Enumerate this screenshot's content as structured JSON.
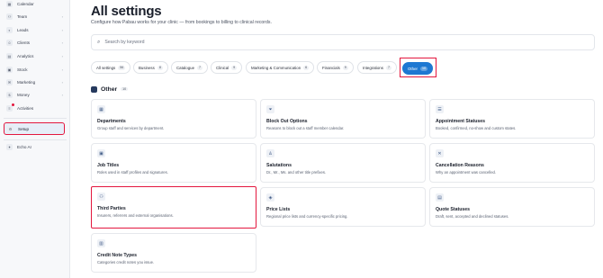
{
  "sidebar": {
    "items": [
      {
        "label": "Calendar",
        "icon": "calendar-icon",
        "glyph": "▦",
        "chevron": ""
      },
      {
        "label": "Team",
        "icon": "team-icon",
        "glyph": "⚇",
        "chevron": "›"
      },
      {
        "label": "Leads",
        "icon": "leads-icon",
        "glyph": "◐",
        "chevron": "›"
      },
      {
        "label": "Clients",
        "icon": "clients-icon",
        "glyph": "☺",
        "chevron": "›"
      },
      {
        "label": "Analytics",
        "icon": "analytics-icon",
        "glyph": "▤",
        "chevron": "›"
      },
      {
        "label": "Stock",
        "icon": "stock-icon",
        "glyph": "▣",
        "chevron": "›"
      },
      {
        "label": "Marketing",
        "icon": "marketing-icon",
        "glyph": "✉",
        "chevron": "›"
      },
      {
        "label": "Money",
        "icon": "money-icon",
        "glyph": "$",
        "chevron": "›"
      },
      {
        "label": "Activities",
        "icon": "activities-icon",
        "glyph": "≡",
        "chevron": ""
      },
      {
        "label": "Setup",
        "icon": "setup-icon",
        "glyph": "⚙",
        "chevron": ""
      },
      {
        "label": "Echo AI",
        "icon": "echo-ai-icon",
        "glyph": "✦",
        "chevron": ""
      }
    ]
  },
  "header": {
    "title": "All settings",
    "subtitle": "Configure how Pabau works for your clinic — from bookings to billing to clinical records."
  },
  "search": {
    "placeholder": "Search by keyword"
  },
  "tabs": [
    {
      "label": "All settings",
      "count": "56"
    },
    {
      "label": "Business",
      "count": "8"
    },
    {
      "label": "Catalogue",
      "count": "7"
    },
    {
      "label": "Clinical",
      "count": "9"
    },
    {
      "label": "Marketing & Communication",
      "count": "6"
    },
    {
      "label": "Financials",
      "count": "9"
    },
    {
      "label": "Integrations",
      "count": "7"
    },
    {
      "label": "Other",
      "count": "10"
    }
  ],
  "section": {
    "title": "Other",
    "count": "10"
  },
  "cards": [
    {
      "title": "Departments",
      "desc": "Group staff and services by department.",
      "icon": "departments-icon",
      "glyph": "▦"
    },
    {
      "title": "Block Out Options",
      "desc": "Reasons to block out a staff member calendar.",
      "icon": "filter-icon",
      "glyph": "⏷"
    },
    {
      "title": "Appointment Statuses",
      "desc": "Booked, confirmed, no-show and custom states.",
      "icon": "list-icon",
      "glyph": "☰"
    },
    {
      "title": "Job Titles",
      "desc": "Roles used in staff profiles and signatures.",
      "icon": "briefcase-icon",
      "glyph": "▣"
    },
    {
      "title": "Salutations",
      "desc": "Dr., Mr., Ms. and other title prefixes.",
      "icon": "user-tag-icon",
      "glyph": "♙"
    },
    {
      "title": "Cancellation Reasons",
      "desc": "Why an appointment was cancelled.",
      "icon": "x-icon",
      "glyph": "✕"
    },
    {
      "title": "Third Parties",
      "desc": "Insurers, referrers and external organisations.",
      "icon": "organisations-icon",
      "glyph": "⚇"
    },
    {
      "title": "Price Lists",
      "desc": "Regional price lists and currency-specific pricing.",
      "icon": "price-tag-icon",
      "glyph": "◈"
    },
    {
      "title": "Quote Statuses",
      "desc": "Draft, sent, accepted and declined statuses.",
      "icon": "document-icon",
      "glyph": "▤"
    },
    {
      "title": "Credit Note Types",
      "desc": "Categories credit notes you issue.",
      "icon": "receipt-icon",
      "glyph": "▥"
    }
  ],
  "colors": {
    "accent": "#1e78d2",
    "highlight": "#e3173e",
    "section_icon": "#263a5e"
  }
}
